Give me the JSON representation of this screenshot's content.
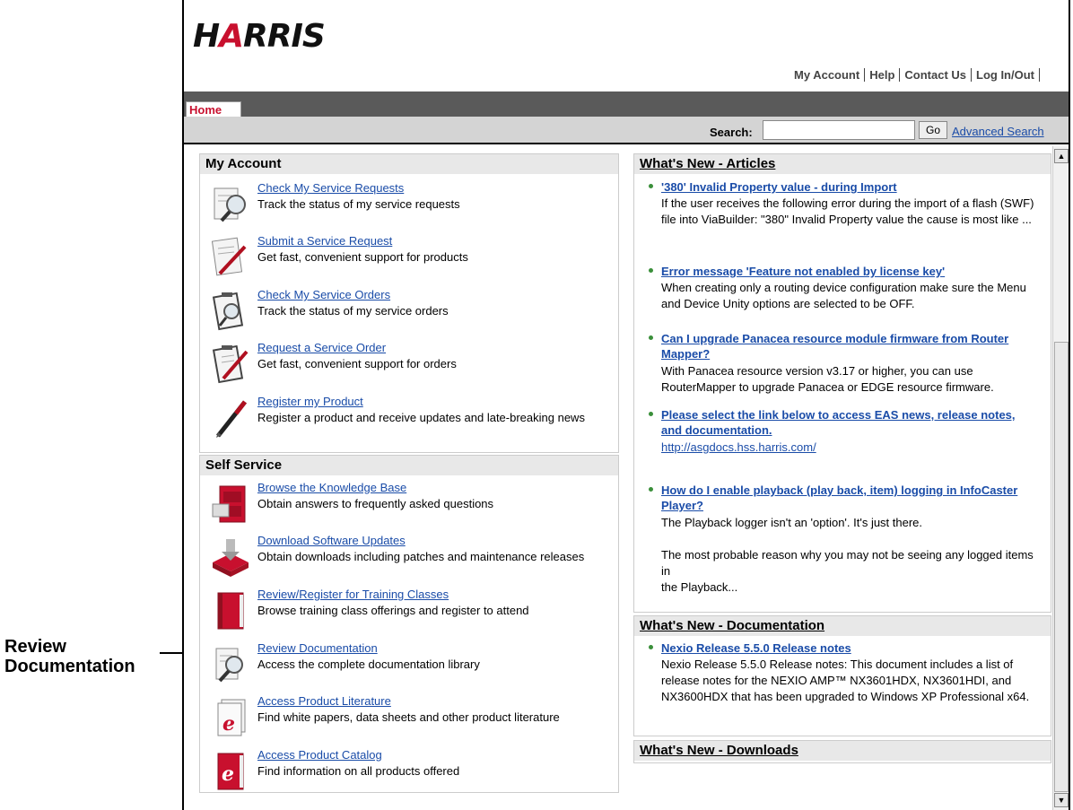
{
  "annotation": {
    "line1": "Review",
    "line2": "Documentation"
  },
  "header": {
    "logo_text": "HARRIS",
    "links": [
      "My Account",
      "Help",
      "Contact Us",
      "Log In/Out"
    ]
  },
  "tabs": {
    "home": "Home"
  },
  "search": {
    "label": "Search:",
    "value": "",
    "go": "Go",
    "advanced": "Advanced Search"
  },
  "my_account": {
    "title": "My Account",
    "items": [
      {
        "label": "Check My Service Requests",
        "desc": "Track the status of my service requests",
        "icon": "magnifier-document-icon"
      },
      {
        "label": "Submit a Service Request",
        "desc": "Get fast, convenient support for products",
        "icon": "document-pen-icon"
      },
      {
        "label": "Check My Service Orders",
        "desc": "Track the status of my service orders",
        "icon": "clipboard-magnifier-icon"
      },
      {
        "label": "Request a Service Order",
        "desc": "Get fast, convenient support for orders",
        "icon": "clipboard-pen-icon"
      },
      {
        "label": "Register my Product",
        "desc": "Register a product and receive updates and late-breaking news",
        "icon": "pen-icon"
      }
    ]
  },
  "self_service": {
    "title": "Self Service",
    "items": [
      {
        "label": "Browse the Knowledge Base",
        "desc": "Obtain answers to frequently asked questions",
        "icon": "file-cabinet-icon"
      },
      {
        "label": "Download Software Updates",
        "desc": "Obtain downloads including patches and maintenance releases",
        "icon": "download-icon"
      },
      {
        "label": "Review/Register for Training Classes",
        "desc": "Browse training class offerings and register to attend",
        "icon": "book-icon"
      },
      {
        "label": "Review Documentation",
        "desc": "Access the complete documentation library",
        "icon": "magnifier-document-icon"
      },
      {
        "label": "Access Product Literature",
        "desc": "Find white papers, data sheets and other product literature",
        "icon": "e-document-icon"
      },
      {
        "label": "Access Product Catalog",
        "desc": "Find information on all products offered",
        "icon": "e-book-icon"
      }
    ]
  },
  "articles": {
    "title": "What's New - Articles",
    "items": [
      {
        "title": "'380' Invalid Property value - during Import",
        "body": "If the user receives the following error during the import of a flash (SWF) file into ViaBuilder: \"380\" Invalid Property value the cause is most like ..."
      },
      {
        "title": "Error message 'Feature not enabled by license key'",
        "body": "When creating only a routing device configuration make sure the Menu and Device Unity options are selected to be OFF."
      },
      {
        "title": "Can I upgrade Panacea resource module firmware from Router Mapper?",
        "body": "With Panacea resource version v3.17 or higher, you can use RouterMapper to upgrade Panacea or EDGE resource firmware."
      },
      {
        "title": "Please select the link below to access EAS news, release notes, and documentation.",
        "link": "http://asgdocs.hss.harris.com/"
      },
      {
        "title": "How do I enable playback (play back, item) logging in InfoCaster Player?",
        "body": "The Playback logger isn't an 'option'. It's just there.",
        "body2": "The most probable reason why you may not be seeing any logged items in",
        "body3": "the Playback..."
      }
    ]
  },
  "documentation": {
    "title": "What's New - Documentation",
    "items": [
      {
        "title": "Nexio Release 5.5.0 Release notes",
        "body": "Nexio Release 5.5.0 Release notes: This document includes a list of release notes for the NEXIO AMP™ NX3601HDX, NX3601HDI, and NX3600HDX that has been upgraded to Windows XP Professional x64."
      }
    ]
  },
  "downloads": {
    "title": "What's New - Downloads"
  },
  "colors": {
    "brand_red": "#c8102e",
    "link_blue": "#1a4ca8",
    "tab_bar": "#5a5a5a"
  }
}
